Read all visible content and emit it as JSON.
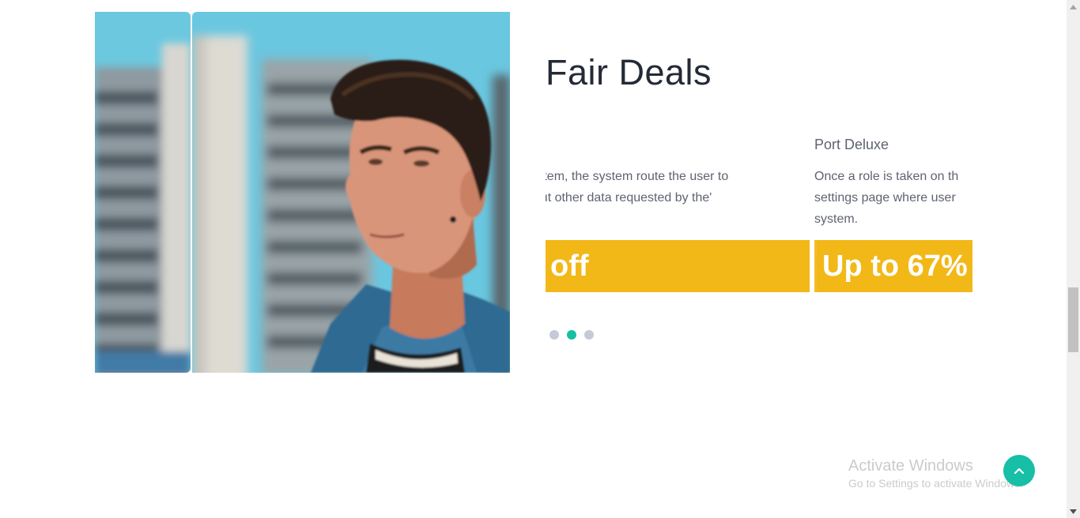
{
  "deals": {
    "title": "Fair Deals",
    "cards": [
      {
        "name": "",
        "description_line1": "e system, the system route the user to",
        "description_line2": "'s input other data requested by the",
        "banner": "off"
      },
      {
        "name": "Port Deluxe",
        "description": "Once a role is taken on the settings page where user system.",
        "description_line1": "Once a role is taken on th",
        "description_line2": "settings page where user",
        "description_line3": "system.",
        "banner": "Up to 67%"
      }
    ],
    "pagination": {
      "count": 3,
      "active_index": 1
    }
  },
  "carousel": {
    "images": [
      "blurred building background",
      "young man with dark quiff in denim shirt against blue sky"
    ]
  },
  "overlay": {
    "activate_title": "Activate Windows",
    "activate_subtitle": "Go to Settings to activate Windows."
  },
  "back_to_top": {
    "icon": "chevron-up-icon"
  },
  "colors": {
    "accent": "#16bfa6",
    "banner": "#f2b818",
    "title": "#242a36",
    "text": "#5e6370",
    "dot_inactive": "#c4cad6"
  }
}
